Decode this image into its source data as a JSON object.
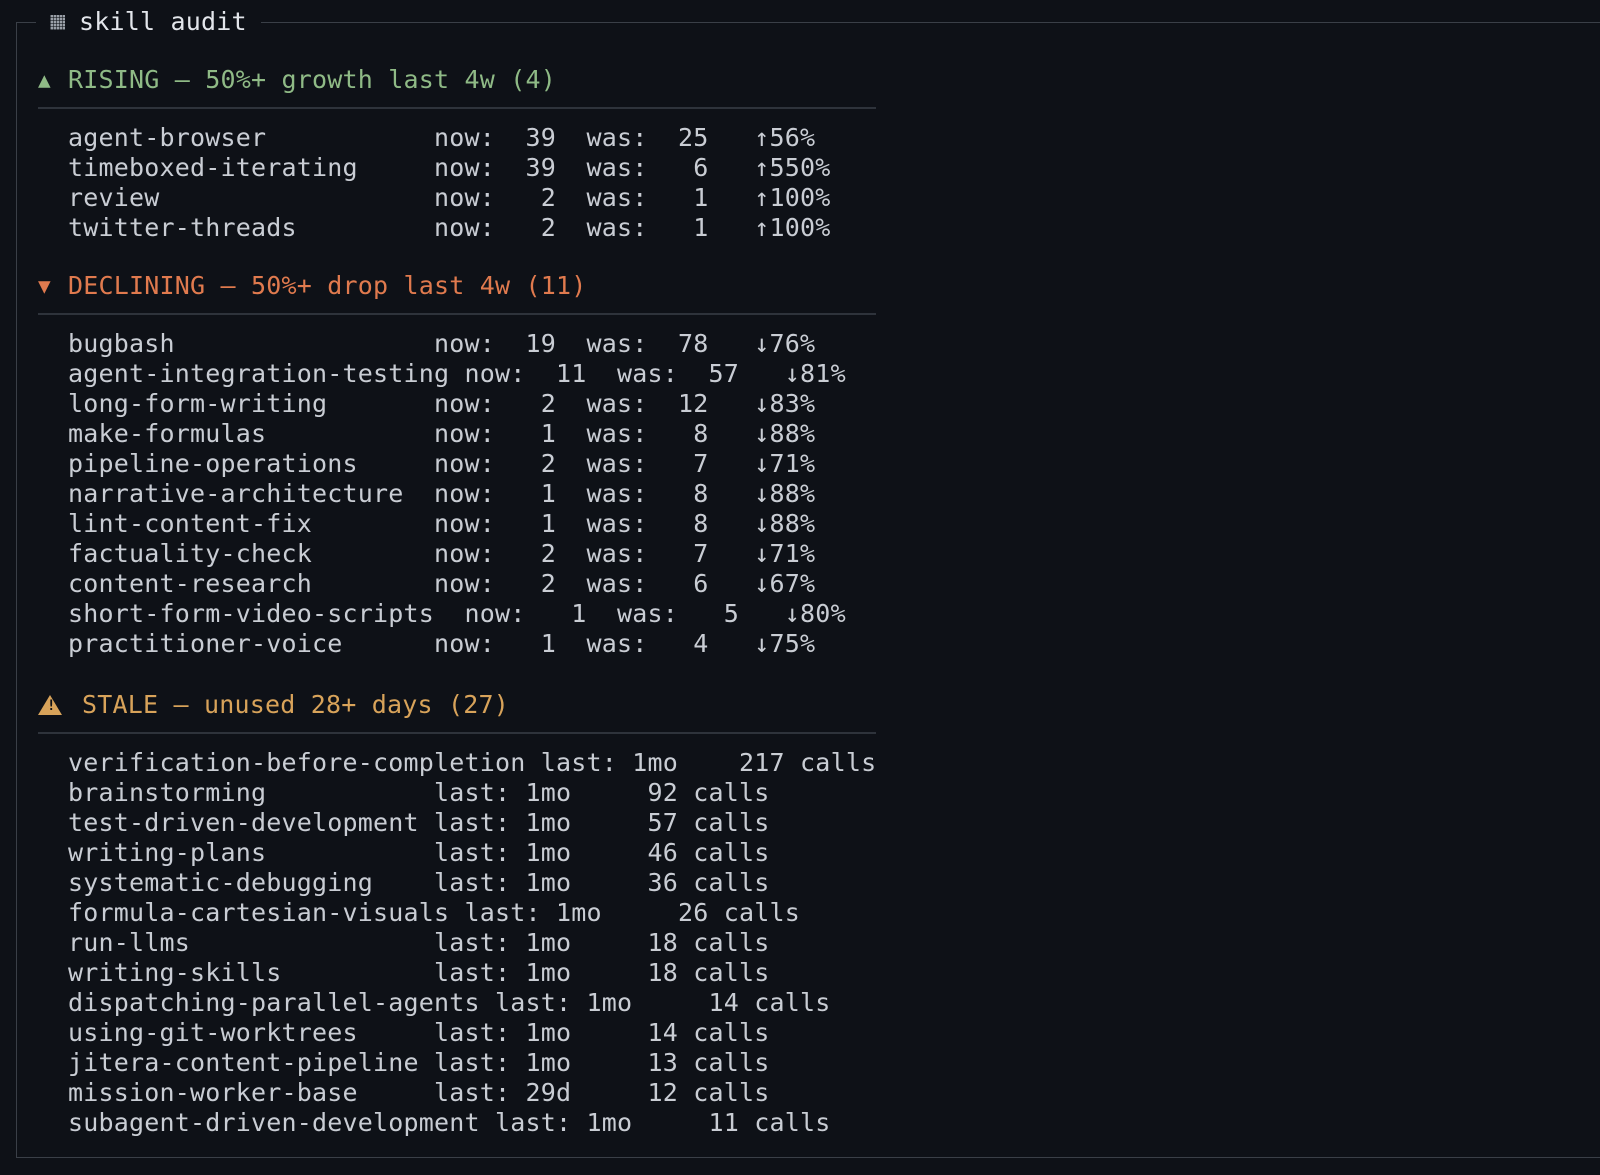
{
  "panel": {
    "icon": "panel-square-icon",
    "title": "skill audit"
  },
  "colors": {
    "background": "#0e1117",
    "border": "#3a3f47",
    "text": "#c9cdd4",
    "rising": "#8fba86",
    "declining": "#e07a4e",
    "stale": "#d8a35a"
  },
  "rising": {
    "icon": "triangle-up-icon",
    "glyph": "▲",
    "header": "RISING — 50%+ growth last 4w (4)",
    "rows": [
      "agent-browser           now:  39  was:  25   ↑56%",
      "timeboxed-iterating     now:  39  was:   6   ↑550%",
      "review                  now:   2  was:   1   ↑100%",
      "twitter-threads         now:   2  was:   1   ↑100%"
    ]
  },
  "declining": {
    "icon": "triangle-down-icon",
    "glyph": "▼",
    "header": "DECLINING — 50%+ drop last 4w (11)",
    "rows": [
      "bugbash                 now:  19  was:  78   ↓76%",
      "agent-integration-testing now:  11  was:  57   ↓81%",
      "long-form-writing       now:   2  was:  12   ↓83%",
      "make-formulas           now:   1  was:   8   ↓88%",
      "pipeline-operations     now:   2  was:   7   ↓71%",
      "narrative-architecture  now:   1  was:   8   ↓88%",
      "lint-content-fix        now:   1  was:   8   ↓88%",
      "factuality-check        now:   2  was:   7   ↓71%",
      "content-research        now:   2  was:   6   ↓67%",
      "short-form-video-scripts  now:   1  was:   5   ↓80%",
      "practitioner-voice      now:   1  was:   4   ↓75%"
    ]
  },
  "stale": {
    "icon": "warning-icon",
    "header": "STALE — unused 28+ days (27)",
    "rows": [
      "verification-before-completion last: 1mo    217 calls",
      "brainstorming           last: 1mo     92 calls",
      "test-driven-development last: 1mo     57 calls",
      "writing-plans           last: 1mo     46 calls",
      "systematic-debugging    last: 1mo     36 calls",
      "formula-cartesian-visuals last: 1mo     26 calls",
      "run-llms                last: 1mo     18 calls",
      "writing-skills          last: 1mo     18 calls",
      "dispatching-parallel-agents last: 1mo     14 calls",
      "using-git-worktrees     last: 1mo     14 calls",
      "jitera-content-pipeline last: 1mo     13 calls",
      "mission-worker-base     last: 29d     12 calls",
      "subagent-driven-development last: 1mo     11 calls"
    ]
  }
}
